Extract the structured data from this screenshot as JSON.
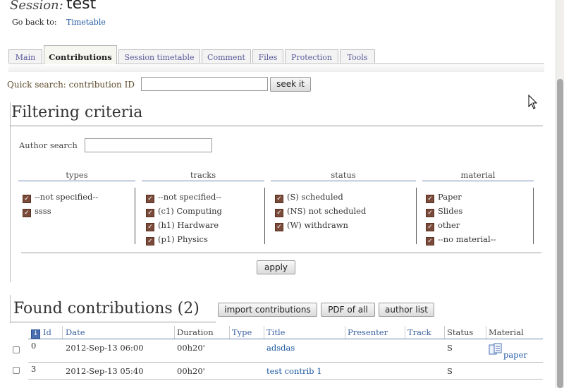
{
  "header": {
    "session_label": "Session:",
    "session_title": "test",
    "goback_label": "Go back to:",
    "goback_link": "Timetable"
  },
  "tabs": [
    {
      "label": "Main"
    },
    {
      "label": "Contributions",
      "active": true
    },
    {
      "label": "Session timetable"
    },
    {
      "label": "Comment"
    },
    {
      "label": "Files"
    },
    {
      "label": "Protection"
    },
    {
      "label": "Tools"
    }
  ],
  "quick_search": {
    "label": "Quick search: contribution ID",
    "value": "",
    "button": "seek it"
  },
  "filter": {
    "title": "Filtering criteria",
    "author_label": "Author search",
    "author_value": "",
    "columns": [
      {
        "title": "types",
        "items": [
          "--not specified--",
          "ssss"
        ]
      },
      {
        "title": "tracks",
        "items": [
          "--not specified--",
          "(c1) Computing",
          "(h1) Hardware",
          "(p1) Physics"
        ]
      },
      {
        "title": "status",
        "items": [
          "(S) scheduled",
          "(NS) not scheduled",
          "(W) withdrawn"
        ]
      },
      {
        "title": "material",
        "items": [
          "Paper",
          "Slides",
          "other",
          "--no material--"
        ]
      }
    ],
    "apply_button": "apply"
  },
  "found": {
    "title": "Found contributions (2)",
    "import_button": "import contributions",
    "pdf_button": "PDF of all",
    "authorlist_button": "author list",
    "columns": {
      "id": "Id",
      "date": "Date",
      "duration": "Duration",
      "type": "Type",
      "title": "Title",
      "presenter": "Presenter",
      "track": "Track",
      "status": "Status",
      "material": "Material"
    },
    "rows": [
      {
        "id": "0",
        "date": "2012-Sep-13 06:00",
        "duration": "00h20'",
        "type": "",
        "title": "adsdas",
        "presenter": "",
        "track": "",
        "status": "S",
        "material": "paper",
        "material_icon": "documents-icon"
      },
      {
        "id": "3",
        "date": "2012-Sep-13 05:40",
        "duration": "00h20'",
        "type": "",
        "title": "test contrib 1",
        "presenter": "",
        "track": "",
        "status": "S",
        "material": ""
      }
    ]
  },
  "icons": {
    "checkbox_checked": "checkbox-checked-icon",
    "sort_down": "sort-down-icon",
    "mouse_cursor": "arrow-cursor-icon"
  },
  "colors": {
    "link": "#1a56a0",
    "checkbox_fill": "#7a4a3a",
    "column_line": "#6a86b3"
  }
}
